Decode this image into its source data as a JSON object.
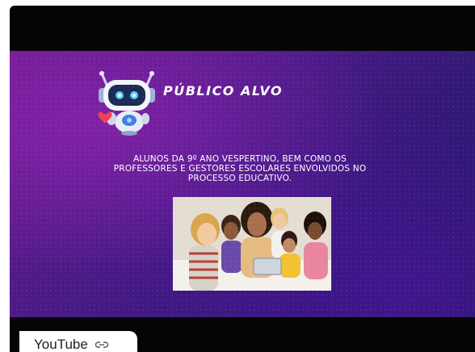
{
  "slide": {
    "title": "PÚBLICO ALVO",
    "body_line1": "ALUNOS DA 9º ANO VESPERTINO, BEM COMO OS",
    "body_line2": "PROFESSORES E GESTORES ESCOLARES ENVOLVIDOS NO",
    "body_line3": "PROCESSO EDUCATIVO."
  },
  "badge": {
    "label": "YouTube"
  },
  "icons": {
    "robot": "robot-mascot-icon",
    "link": "link-icon"
  },
  "colors": {
    "slide_purple": "#5a1a8c",
    "slide_blue": "#1d1660",
    "letterbox": "#050505",
    "badge_bg": "#ffffff"
  }
}
